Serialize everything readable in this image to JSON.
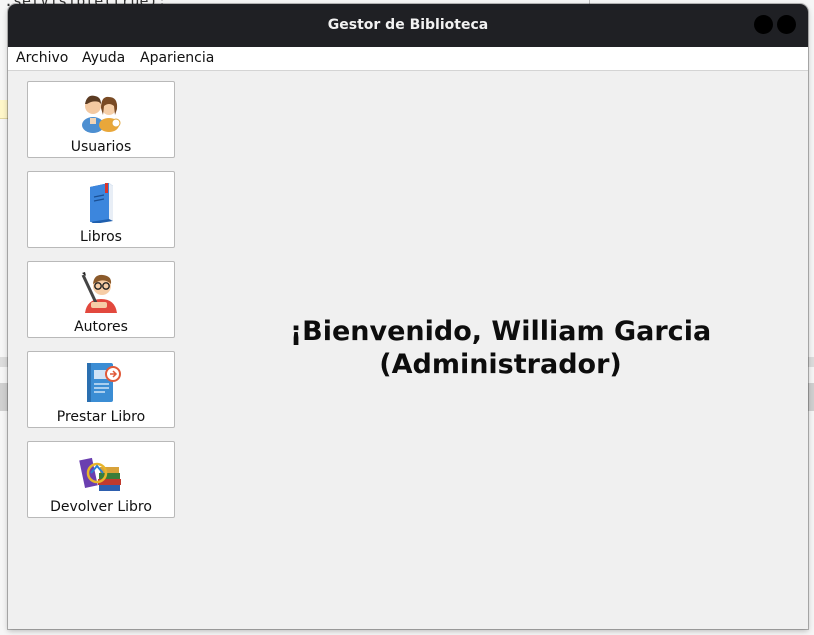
{
  "window": {
    "title": "Gestor de Biblioteca"
  },
  "menu": {
    "items": [
      "Archivo",
      "Ayuda",
      "Apariencia"
    ]
  },
  "sidebar": {
    "buttons": [
      {
        "label": "Usuarios",
        "icon": "users-icon"
      },
      {
        "label": "Libros",
        "icon": "book-icon"
      },
      {
        "label": "Autores",
        "icon": "author-icon"
      },
      {
        "label": "Prestar Libro",
        "icon": "lend-book-icon"
      },
      {
        "label": "Devolver Libro",
        "icon": "return-book-icon"
      }
    ]
  },
  "main": {
    "welcome_line1": "¡Bienvenido, William Garcia",
    "welcome_line2": "(Administrador)"
  },
  "background": {
    "top_code": ".setVisible(true);"
  },
  "colors": {
    "titlebar": "#1f2024",
    "window_bg": "#f0f0f0",
    "button_bg": "#ffffff"
  }
}
